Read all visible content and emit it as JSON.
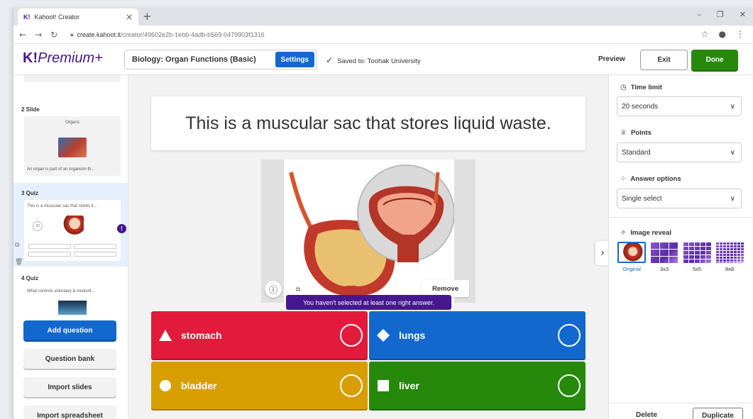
{
  "browser": {
    "tab_title": "Kahoot! Creator",
    "tab_favicon": "K!",
    "url_host": "create.kahoot.it",
    "url_path": "/creator/49602e2b-1ebb-4adb-b569-0479903f1316"
  },
  "header": {
    "logo_brand": "K!",
    "logo_tier": "Premium+",
    "kahoot_title": "Biology: Organ Functions (Basic)",
    "settings_label": "Settings",
    "saved_text": "Saved to: Toohak University",
    "preview_label": "Preview",
    "exit_label": "Exit",
    "done_label": "Done"
  },
  "sidebar": {
    "items": [
      {
        "label": "2  Slide",
        "thumb_title": "Organs",
        "thumb_caption": "An organ is part of an organism th..."
      },
      {
        "label": "3  Quiz",
        "thumb_title": "This is a muscular sac that stores li...",
        "timer": "20",
        "warning": "!"
      },
      {
        "label": "4  Quiz",
        "thumb_title": "What controls voluntary & involunt..."
      }
    ],
    "add_question": "Add question",
    "question_bank": "Question bank",
    "import_slides": "Import slides",
    "import_spreadsheet": "Import spreadsheet"
  },
  "editor": {
    "question": "This is a muscular sac that stores liquid waste.",
    "remove_label": "Remove",
    "tooltip": "You haven't selected at least one right answer.",
    "answers": [
      {
        "text": "stomach",
        "shape": "triangle",
        "color": "#e21b3c"
      },
      {
        "text": "lungs",
        "shape": "diamond",
        "color": "#1368ce"
      },
      {
        "text": "bladder",
        "shape": "circle",
        "color": "#d89e00"
      },
      {
        "text": "liver",
        "shape": "square",
        "color": "#26890c"
      }
    ]
  },
  "right_panel": {
    "time_limit_label": "Time limit",
    "time_limit_value": "20 seconds",
    "points_label": "Points",
    "points_value": "Standard",
    "answer_options_label": "Answer options",
    "answer_options_value": "Single select",
    "image_reveal_label": "Image reveal",
    "reveal_options": [
      "Original",
      "3x3",
      "5x5",
      "8x8"
    ],
    "delete_label": "Delete",
    "duplicate_label": "Duplicate"
  },
  "colors": {
    "kahoot_purple": "#46178f",
    "accent_blue": "#1368ce",
    "done_green": "#26890c"
  }
}
